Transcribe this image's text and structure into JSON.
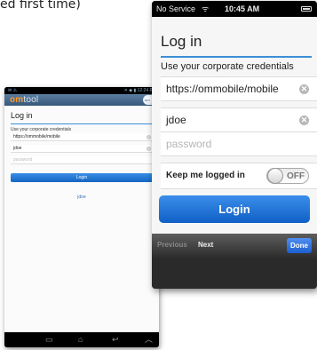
{
  "caption": "ed first time)",
  "android": {
    "status_left": "✉ ⚠",
    "status_right": "✕ ◆ ▮ 12:24 PM",
    "logo_om": "om",
    "logo_tool": "tool",
    "corner_label": "om",
    "title": "Log in",
    "hint": "Use your corporate credentials",
    "url_value": "https://ommobile/mobile",
    "user_value": "jdoe",
    "password_placeholder": "password",
    "login_label": "Login",
    "user_link": "jdoe",
    "clear_glyph": "✕",
    "nav_back": "▭",
    "nav_home": "⌂",
    "nav_recent": "↩",
    "nav_up": "︿"
  },
  "iphone": {
    "service": "No Service",
    "wifi": "ᯤ",
    "time": "10:45 AM",
    "title": "Log in",
    "hint": "Use your corporate credentials",
    "url_value": "https://ommobile/mobile",
    "user_value": "jdoe",
    "password_placeholder": "password",
    "clear_glyph": "✕",
    "keep_label": "Keep me logged in",
    "toggle_state": "OFF",
    "login_label": "Login",
    "previous_label": "Previous",
    "next_label": "Next",
    "done_label": "Done"
  }
}
